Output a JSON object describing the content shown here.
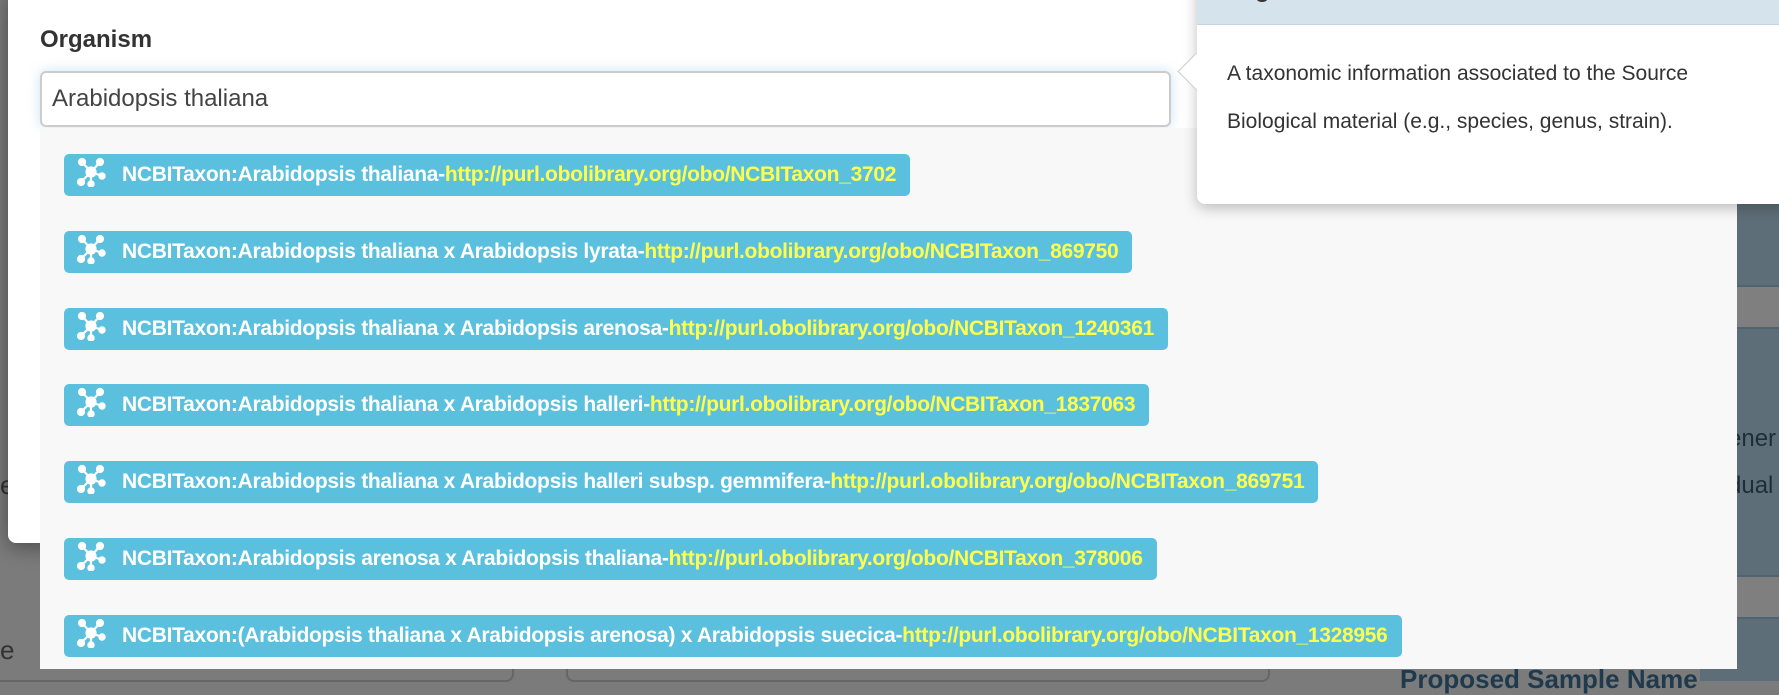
{
  "background": {
    "left_fragments": [
      "e",
      "e"
    ],
    "right_fragments": [
      "ener",
      "dual"
    ],
    "section_heading": "Proposed Sample Name"
  },
  "field": {
    "label": "Organism",
    "value": "Arabidopsis thaliana"
  },
  "popover": {
    "title": "Organism",
    "body": "A taxonomic information associated to the Source Biological material (e.g., species, genus, strain)."
  },
  "suggestions": [
    {
      "name": "NCBITaxon:Arabidopsis thaliana",
      "url": "http://purl.obolibrary.org/obo/NCBITaxon_3702"
    },
    {
      "name": "NCBITaxon:Arabidopsis thaliana x Arabidopsis lyrata",
      "url": "http://purl.obolibrary.org/obo/NCBITaxon_869750"
    },
    {
      "name": "NCBITaxon:Arabidopsis thaliana x Arabidopsis arenosa",
      "url": "http://purl.obolibrary.org/obo/NCBITaxon_1240361"
    },
    {
      "name": "NCBITaxon:Arabidopsis thaliana x Arabidopsis halleri",
      "url": "http://purl.obolibrary.org/obo/NCBITaxon_1837063"
    },
    {
      "name": "NCBITaxon:Arabidopsis thaliana x Arabidopsis halleri subsp. gemmifera",
      "url": "http://purl.obolibrary.org/obo/NCBITaxon_869751"
    },
    {
      "name": "NCBITaxon:Arabidopsis arenosa x Arabidopsis thaliana",
      "url": "http://purl.obolibrary.org/obo/NCBITaxon_378006"
    },
    {
      "name": "NCBITaxon:(Arabidopsis thaliana x Arabidopsis arenosa) x Arabidopsis suecica",
      "url": "http://purl.obolibrary.org/obo/NCBITaxon_1328956"
    }
  ],
  "separator": " - ",
  "colors": {
    "item_bg": "#5bc0de",
    "url_text": "#ffff4d",
    "popover_header": "#d5e3ec"
  },
  "icons": {
    "suggestion": "ontology-network-icon"
  }
}
